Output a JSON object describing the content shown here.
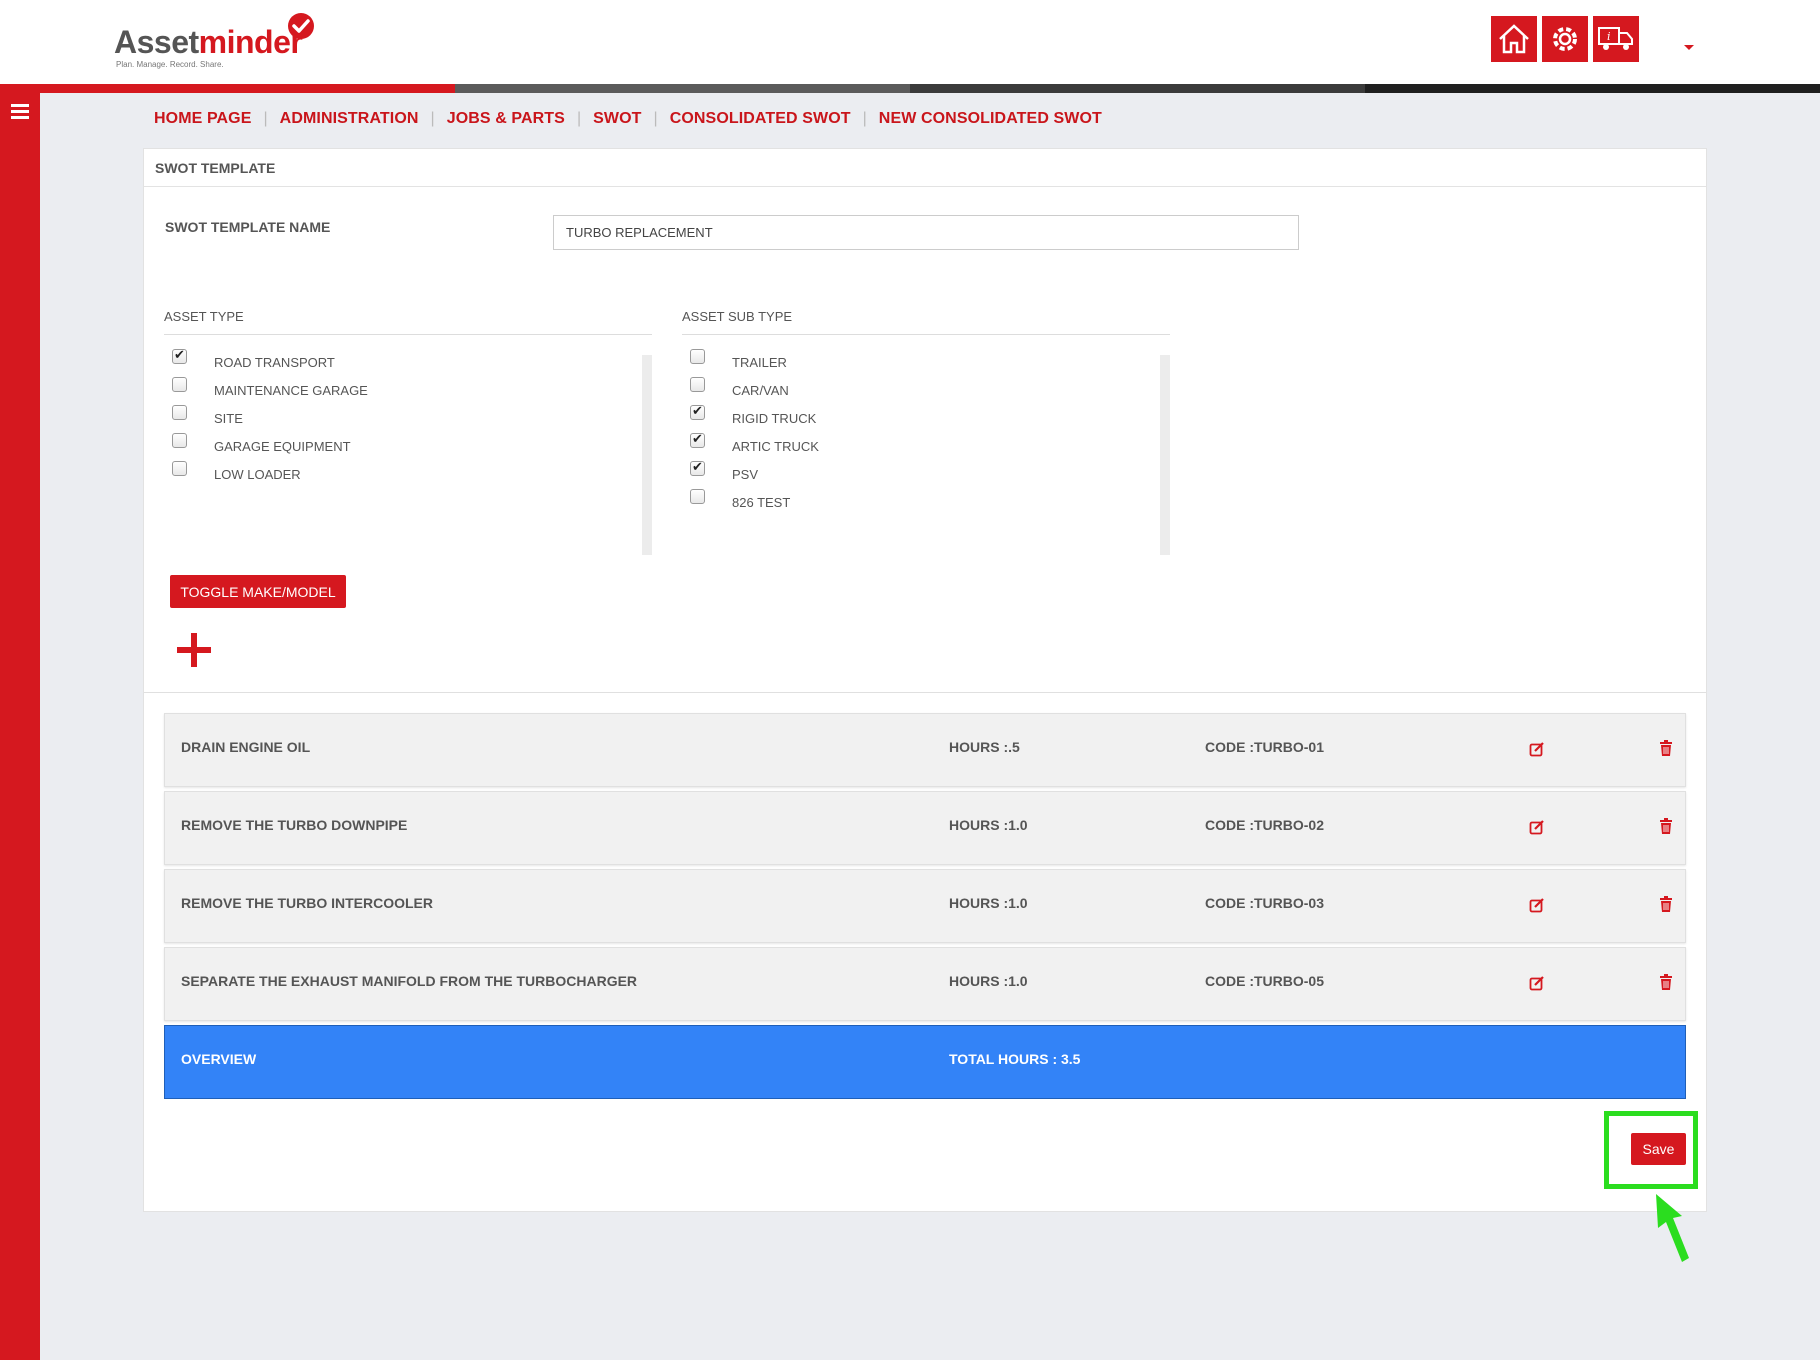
{
  "app": {
    "brand_main": "Asset",
    "brand_accent": "minder",
    "tagline": "Plan. Manage. Record. Share."
  },
  "header": {
    "icons": [
      "home-icon",
      "gear-icon",
      "truck-info-icon"
    ]
  },
  "colors": {
    "brand_red": "#d5181f",
    "overview_blue": "#3383f7",
    "highlight_green": "#2bdd1f",
    "bar_segments": [
      "#d5181f",
      "#5b5b5b",
      "#3b3b3b",
      "#1f1f1f"
    ]
  },
  "breadcrumb": [
    "HOME PAGE",
    "ADMINISTRATION",
    "JOBS & PARTS",
    "SWOT",
    "CONSOLIDATED SWOT",
    "NEW CONSOLIDATED SWOT"
  ],
  "panel": {
    "title": "SWOT TEMPLATE",
    "name_label": "SWOT TEMPLATE NAME",
    "name_value": "TURBO REPLACEMENT",
    "asset_type_label": "ASSET TYPE",
    "asset_sub_type_label": "ASSET SUB TYPE",
    "asset_types": [
      {
        "label": "ROAD TRANSPORT",
        "checked": true
      },
      {
        "label": "MAINTENANCE GARAGE",
        "checked": false
      },
      {
        "label": "SITE",
        "checked": false
      },
      {
        "label": "GARAGE EQUIPMENT",
        "checked": false
      },
      {
        "label": "LOW LOADER",
        "checked": false
      }
    ],
    "asset_sub_types": [
      {
        "label": "TRAILER",
        "checked": false
      },
      {
        "label": "CAR/VAN",
        "checked": false
      },
      {
        "label": "RIGID TRUCK",
        "checked": true
      },
      {
        "label": "ARTIC TRUCK",
        "checked": true
      },
      {
        "label": "PSV",
        "checked": true
      },
      {
        "label": "826 TEST",
        "checked": false
      }
    ],
    "toggle_label": "TOGGLE MAKE/MODEL"
  },
  "tasks": [
    {
      "name": "DRAIN ENGINE OIL",
      "hours": "HOURS :.5",
      "code": "CODE :TURBO-01"
    },
    {
      "name": "REMOVE THE TURBO DOWNPIPE",
      "hours": "HOURS :1.0",
      "code": "CODE :TURBO-02"
    },
    {
      "name": "REMOVE THE TURBO INTERCOOLER",
      "hours": "HOURS :1.0",
      "code": "CODE :TURBO-03"
    },
    {
      "name": "SEPARATE THE EXHAUST MANIFOLD FROM THE TURBOCHARGER",
      "hours": "HOURS :1.0",
      "code": "CODE :TURBO-05"
    }
  ],
  "overview": {
    "label": "OVERVIEW",
    "total": "TOTAL HOURS : 3.5"
  },
  "save_label": "Save"
}
